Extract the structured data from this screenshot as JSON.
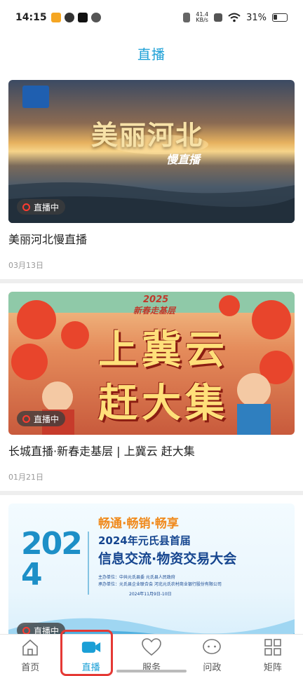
{
  "status_bar": {
    "time": "14:15",
    "net_speed_value": "41.4",
    "net_speed_unit": "KB/s",
    "battery": "31%"
  },
  "header": {
    "title": "直播"
  },
  "feed": {
    "items": [
      {
        "title": "美丽河北慢直播",
        "date": "03月13日",
        "badge": "直播中",
        "thumb_caption_main": "美丽河北",
        "thumb_caption_sub": "慢直播"
      },
      {
        "title": "长城直播·新春走基层 | 上冀云 赶大集",
        "date": "01月21日",
        "badge": "直播中",
        "thumb_caption_year": "2025",
        "thumb_caption_tag": "新春走基层",
        "thumb_caption_line1": "上冀云",
        "thumb_caption_line2": "赶大集"
      },
      {
        "title": "",
        "date": "",
        "badge": "直播中",
        "thumb_slogan": "畅通·畅销·畅享",
        "thumb_year": "2024",
        "thumb_headline1": "2024年元氏县首届",
        "thumb_headline2": "信息交流·物资交易大会",
        "thumb_host": "主办单位：中共元氏县委  元氏县人民政府",
        "thumb_organizer": "承办单位：元氏县企业联合会  河北元氏农村商业银行股份有限公司",
        "thumb_date": "2024年11月9日-10日"
      }
    ]
  },
  "tabbar": {
    "tabs": [
      {
        "label": "首页",
        "icon": "home-icon"
      },
      {
        "label": "直播",
        "icon": "video-camera-icon"
      },
      {
        "label": "服务",
        "icon": "heart-icon"
      },
      {
        "label": "问政",
        "icon": "chat-bubble-icon"
      },
      {
        "label": "矩阵",
        "icon": "grid-icon"
      }
    ],
    "active_index": 1
  },
  "colors": {
    "accent": "#1a9fd6",
    "live_dot": "#ff3b30",
    "highlight": "#e53935"
  }
}
